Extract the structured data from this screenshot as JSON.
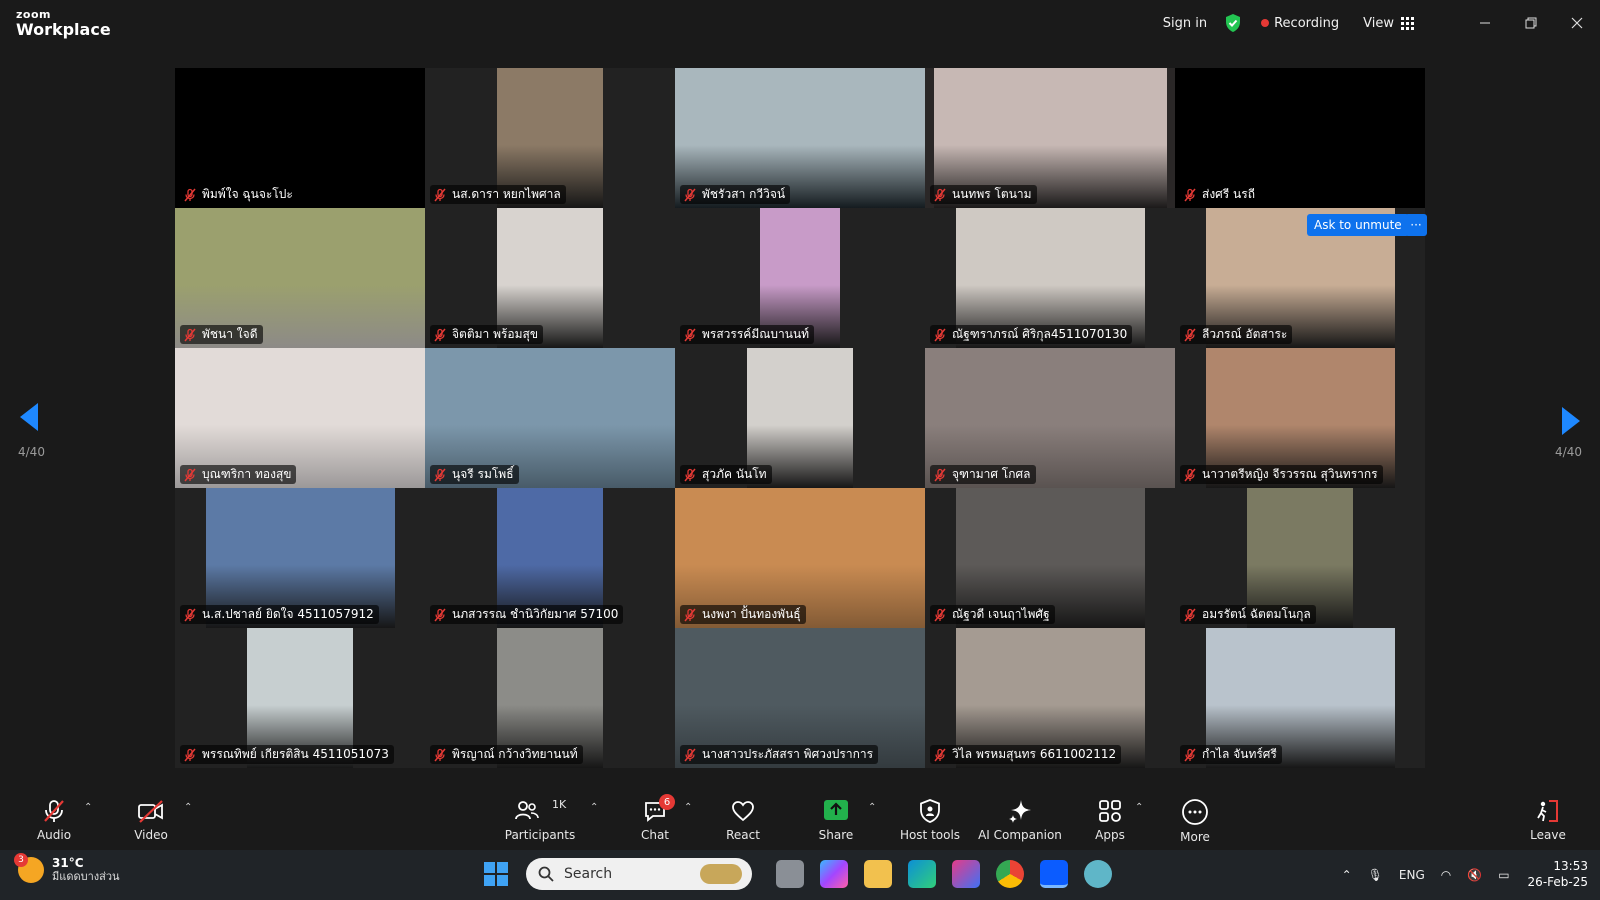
{
  "app": {
    "logo_top": "zoom",
    "logo_bottom": "Workplace"
  },
  "titlebar": {
    "sign_in": "Sign in",
    "recording": "Recording",
    "view": "View"
  },
  "pagination": {
    "left": "4/40",
    "right": "4/40"
  },
  "participants": [
    {
      "name": "พิมพ์ใจ ฉุนจะโปะ",
      "bg": "#000000",
      "video": ""
    },
    {
      "name": "นส.ดารา หยกไพศาล",
      "bg": "#222222",
      "video": "#8c7a66"
    },
    {
      "name": "พัชรัวสา กวีวิจน์",
      "bg": "#1f2a30",
      "video": "#a9b7bd"
    },
    {
      "name": "นนทพร โตนาม",
      "bg": "#2a2727",
      "video": "#c7b8b4"
    },
    {
      "name": "ส่งศรี นรถี",
      "bg": "#000000",
      "video": ""
    },
    {
      "name": "พัชนา ใจดี",
      "bg": "#d8d4cf",
      "video": "#9ba06e"
    },
    {
      "name": "จิตติมา พร้อมสุข",
      "bg": "#222222",
      "video": "#d8d3cf"
    },
    {
      "name": "พรสวรรค์มีณบานนท์",
      "bg": "#222222",
      "video": "#c89bc8"
    },
    {
      "name": "ณัฐฑราภรณ์ ศิริกุล4511070130",
      "bg": "#222222",
      "video": "#cfc9c3"
    },
    {
      "name": "ลีวภรณ์ อัตสาระ",
      "bg": "#222222",
      "video": "#c8ad95"
    },
    {
      "name": "บุณฑริกา ทองสุข",
      "bg": "#efeaea",
      "video": "#e2dbd8"
    },
    {
      "name": "นุจรี รมโพธิ์",
      "bg": "#6f8ca0",
      "video": "#7c97ab"
    },
    {
      "name": "สุวภัค นันโท",
      "bg": "#222222",
      "video": "#d3d0cc"
    },
    {
      "name": "จุฑามาศ โกศล",
      "bg": "#8a7f7c",
      "video": "#8a7f7c"
    },
    {
      "name": "นาวาตรีหญิง จีรวรรณ สุวินทรากร",
      "bg": "#222222",
      "video": "#b0866c"
    },
    {
      "name": "น.ส.ปชาลย์ ยิดใจ 4511057912",
      "bg": "#222222",
      "video": "#5c7aa6"
    },
    {
      "name": "นภสวรรณ ชำนิวิกัยมาศ 57100",
      "bg": "#222222",
      "video": "#4e6aa6"
    },
    {
      "name": "นงพงา ปั้นทองพันธุ์",
      "bg": "#c98b52",
      "video": "#c98b52"
    },
    {
      "name": "ณัฐวดี เจนฤาไพศัฐ",
      "bg": "#222222",
      "video": "#5d5a58"
    },
    {
      "name": "อมรรัตน์ ฉัตตมโนกุล",
      "bg": "#222222",
      "video": "#7b7a62"
    },
    {
      "name": "พรรณทิพย์ เกียรติสิน 4511051073",
      "bg": "#222222",
      "video": "#c7cfd0"
    },
    {
      "name": "พิรญาณ์ กว้างวิทยานนท์",
      "bg": "#222222",
      "video": "#8c8c88"
    },
    {
      "name": "นางสาวประภัสสรา พิศวงปราการ",
      "bg": "#4f5a60",
      "video": "#4f5a60"
    },
    {
      "name": "วิไล พรหมสุนทร 6611002112",
      "bg": "#222222",
      "video": "#a59b92"
    },
    {
      "name": "กำไล จันทร์ศรี",
      "bg": "#222222",
      "video": "#b9c3cc"
    }
  ],
  "actions": {
    "ask_unmute": "Ask to unmute",
    "more": "···"
  },
  "toolbar": {
    "audio": "Audio",
    "video": "Video",
    "participants": "Participants",
    "participants_count": "1K",
    "chat": "Chat",
    "chat_badge": "6",
    "react": "React",
    "share": "Share",
    "host_tools": "Host tools",
    "ai_companion": "AI Companion",
    "apps": "Apps",
    "more": "More",
    "leave": "Leave"
  },
  "taskbar": {
    "weather_badge": "3",
    "temp": "31°C",
    "condition": "มีแดดบางส่วน",
    "search_placeholder": "Search",
    "lang": "ENG",
    "time": "13:53",
    "date": "26-Feb-25"
  },
  "colors": {
    "accent": "#0e72ed",
    "nav_arrow": "#1e88ff",
    "muted_red": "#e53935",
    "share_green": "#22b14c"
  }
}
